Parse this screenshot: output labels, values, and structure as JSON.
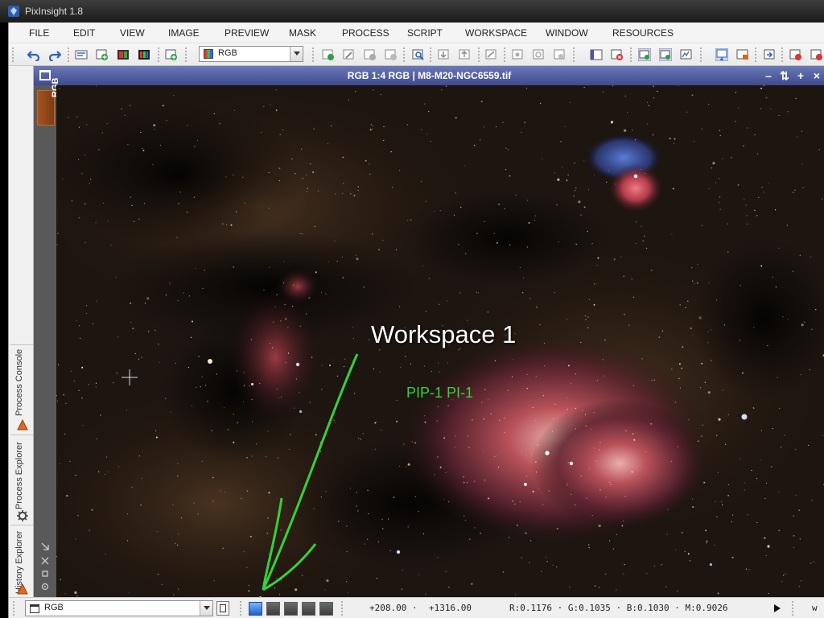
{
  "app": {
    "title": "PixInsight 1.8"
  },
  "menu": [
    "FILE",
    "EDIT",
    "VIEW",
    "IMAGE",
    "PREVIEW",
    "MASK",
    "PROCESS",
    "SCRIPT",
    "WORKSPACE",
    "WINDOW",
    "RESOURCES"
  ],
  "toolbar": {
    "view_select": "RGB"
  },
  "image_window": {
    "title": "RGB 1:4 RGB | M8-M20-NGC6559.tif",
    "view_tab": "RGB"
  },
  "sidebar": {
    "tabs": [
      "Process Console",
      "Process Explorer",
      "History Explorer"
    ]
  },
  "overlay": {
    "title": "Workspace 1",
    "subtitle": "PIP-1 PI-1"
  },
  "statusbar": {
    "view_select": "RGB",
    "x": "+208.00 ·",
    "y": "+1316.00",
    "readout": "R:0.1176 · G:0.1035 · B:0.1030 · M:0.9026",
    "edge_text": "w"
  },
  "colors": {
    "accent": "#4a57a0",
    "annotation": "#36d13a",
    "active_workspace": "#2f78e0",
    "view_tab": "#9a4a18"
  }
}
